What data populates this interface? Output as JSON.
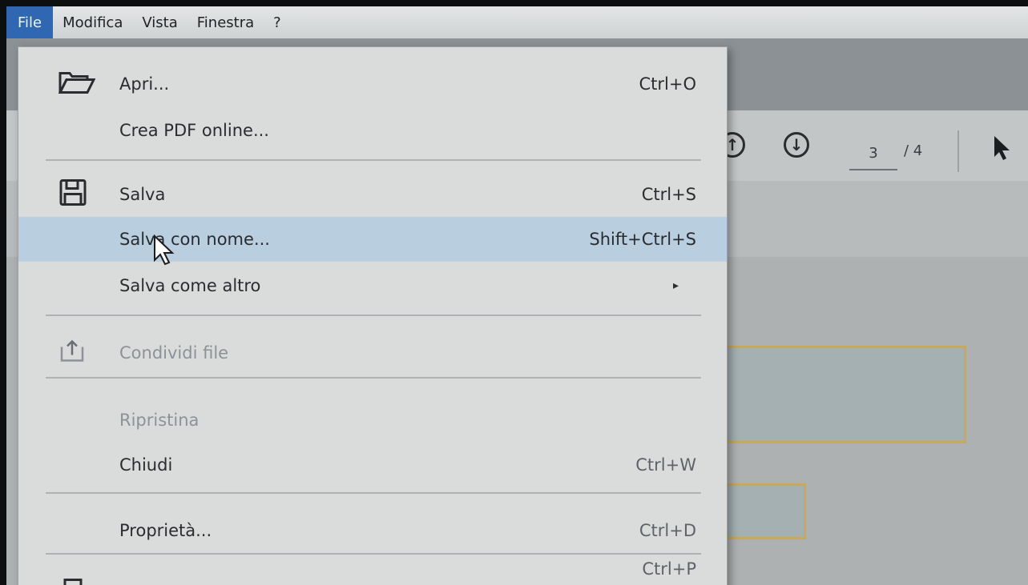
{
  "menubar": {
    "items": [
      "File",
      "Modifica",
      "Vista",
      "Finestra",
      "?"
    ]
  },
  "toolbar": {
    "page_current": "3",
    "page_total": "/ 4",
    "prev_icon": "arrow-up-circle-icon",
    "next_icon": "arrow-down-circle-icon"
  },
  "file_menu": {
    "open": {
      "label": "Apri...",
      "shortcut": "Ctrl+O",
      "icon": "folder-open-icon"
    },
    "create_pdf": {
      "label": "Crea PDF online..."
    },
    "save": {
      "label": "Salva",
      "shortcut": "Ctrl+S",
      "icon": "floppy-disk-icon"
    },
    "save_as": {
      "label": "Salva con nome...",
      "shortcut": "Shift+Ctrl+S"
    },
    "save_other": {
      "label": "Salva come altro",
      "submenu_arrow": "▸"
    },
    "share": {
      "label": "Condividi file",
      "icon": "share-upload-icon"
    },
    "revert": {
      "label": "Ripristina"
    },
    "close": {
      "label": "Chiudi",
      "shortcut": "Ctrl+W"
    },
    "properties": {
      "label": "Proprietà...",
      "shortcut": "Ctrl+D"
    },
    "print": {
      "shortcut": "Ctrl+P",
      "icon": "printer-icon"
    }
  },
  "colors": {
    "menu_active": "#2f67b3",
    "highlight": "#b9cfdf",
    "field_border": "#c8a955"
  }
}
